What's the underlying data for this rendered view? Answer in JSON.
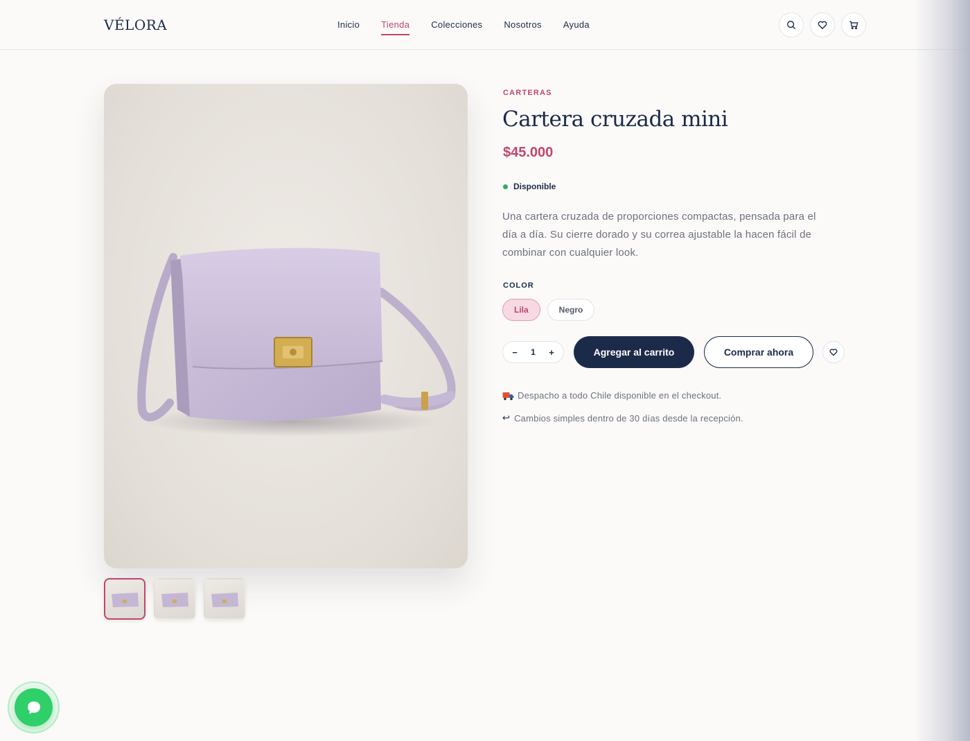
{
  "header": {
    "logo": "VÉLORA",
    "nav": [
      {
        "label": "Inicio",
        "active": false
      },
      {
        "label": "Tienda",
        "active": true
      },
      {
        "label": "Colecciones",
        "active": false
      },
      {
        "label": "Nosotros",
        "active": false
      },
      {
        "label": "Ayuda",
        "active": false
      }
    ],
    "icons": [
      "search-icon",
      "heart-icon",
      "cart-icon"
    ]
  },
  "product": {
    "category": "CARTERAS",
    "title": "Cartera cruzada mini",
    "price": "$45.000",
    "stock": "Disponible",
    "description": "Una cartera cruzada de proporciones compactas, pensada para el día a día. Su cierre dorado y su correa ajustable la hacen fácil de combinar con cualquier look.",
    "color_label": "COLOR",
    "colors": [
      {
        "label": "Lila",
        "selected": true
      },
      {
        "label": "Negro",
        "selected": false
      }
    ],
    "quantity": "1",
    "add_to_cart": "Agregar al carrito",
    "buy_now": "Comprar ahora",
    "shipping_note": "Despacho a todo Chile disponible en el checkout.",
    "returns_note": "Cambios simples dentro de 30 días desde la recepción.",
    "thumbnails": 3,
    "active_thumbnail": 0
  },
  "colors": {
    "accent": "#c0456f",
    "navy": "#1c2a4a",
    "bag": "#c9bcd9",
    "available": "#3aa864",
    "chat": "#2fcf6a"
  }
}
